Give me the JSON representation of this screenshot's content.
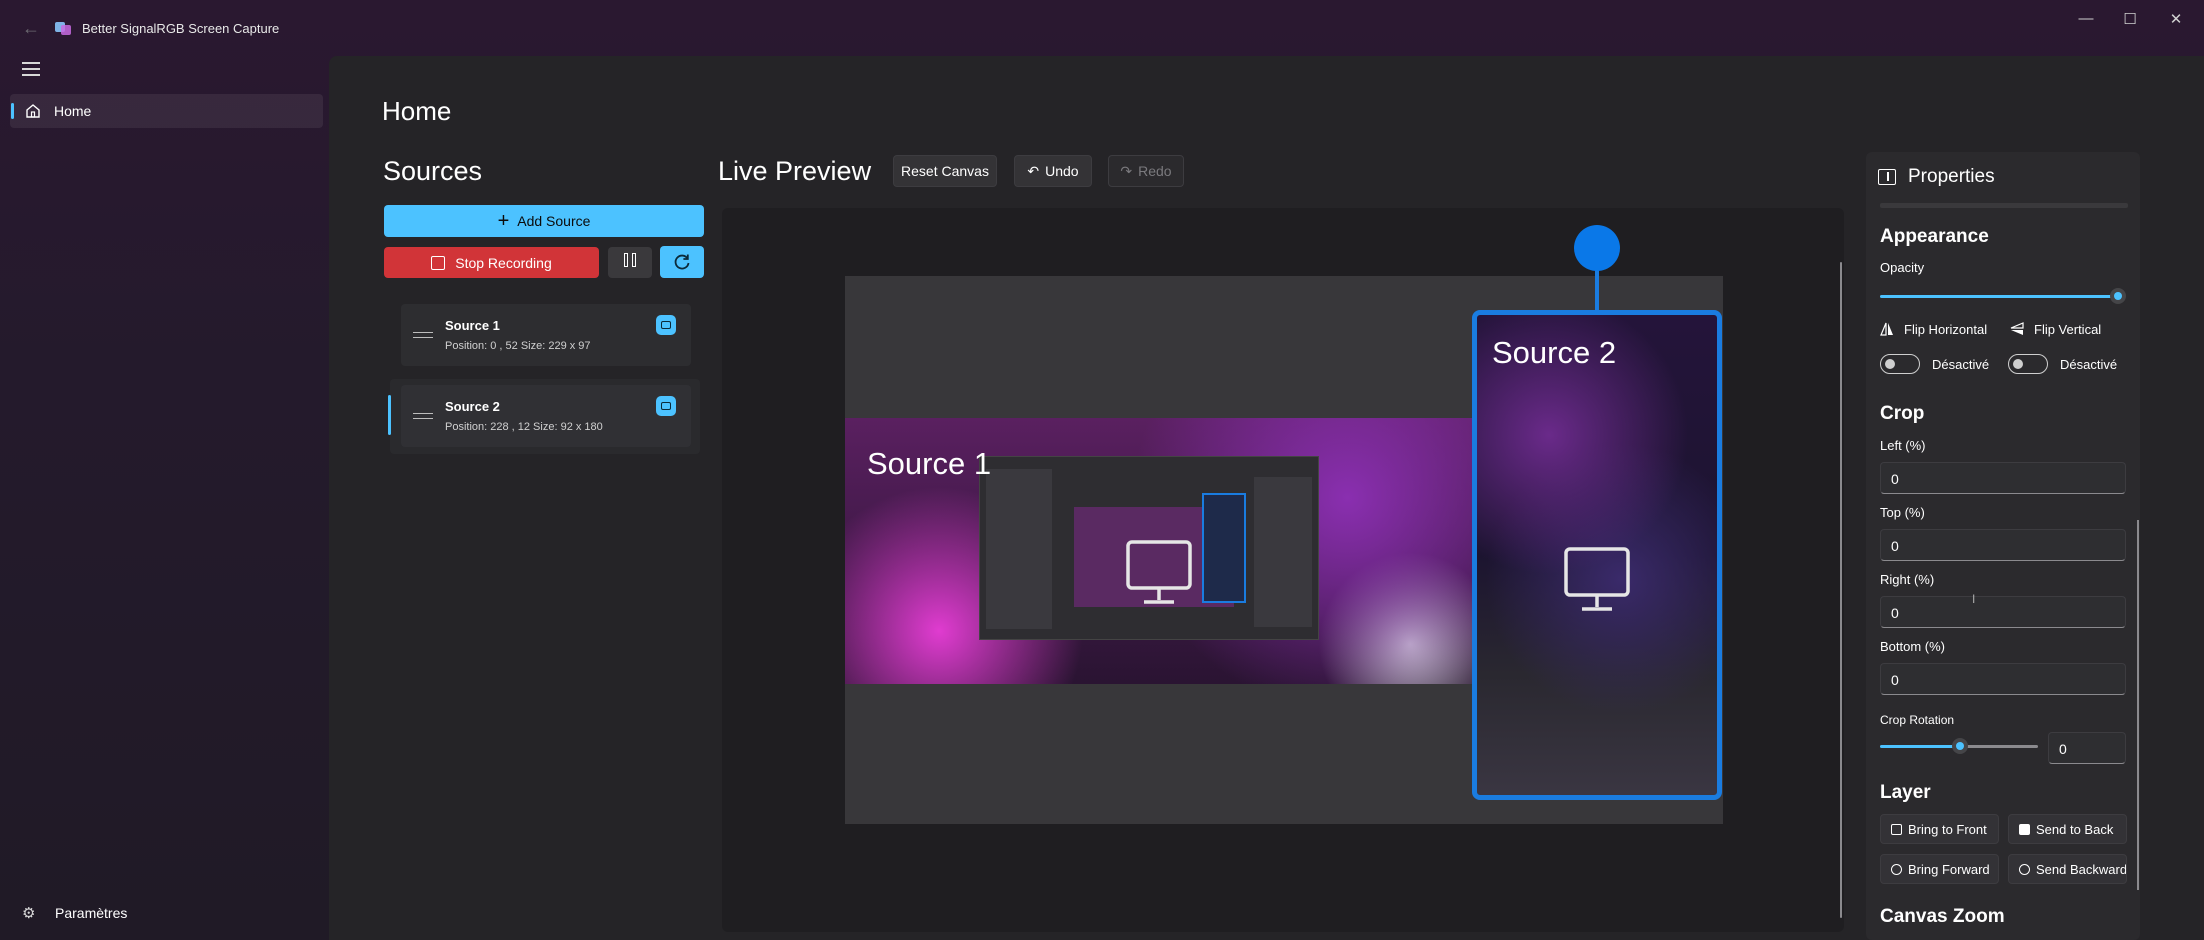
{
  "window": {
    "title": "Better SignalRGB Screen Capture",
    "minimize_glyph": "—",
    "maximize_glyph": "☐",
    "close_glyph": "✕"
  },
  "nav": {
    "home_label": "Home",
    "settings_label": "Paramètres"
  },
  "page": {
    "title": "Home"
  },
  "sources": {
    "title": "Sources",
    "add_label": "Add Source",
    "stop_label": "Stop Recording",
    "items": [
      {
        "name": "Source 1",
        "meta": "Position: 0 , 52  Size: 229 x 97"
      },
      {
        "name": "Source 2",
        "meta": "Position: 228 , 12  Size: 92 x 180"
      }
    ]
  },
  "preview": {
    "title": "Live Preview",
    "reset_label": "Reset Canvas",
    "undo_label": "Undo",
    "redo_label": "Redo",
    "source1_label": "Source 1",
    "source2_label": "Source 2"
  },
  "properties": {
    "title": "Properties",
    "appearance": {
      "heading": "Appearance",
      "opacity_label": "Opacity",
      "opacity_value": 1.0,
      "flip_h_label": "Flip Horizontal",
      "flip_v_label": "Flip Vertical",
      "flip_h_state": "Désactivé",
      "flip_v_state": "Désactivé"
    },
    "crop": {
      "heading": "Crop",
      "left_label": "Left (%)",
      "left_value": "0",
      "top_label": "Top (%)",
      "top_value": "0",
      "right_label": "Right (%)",
      "right_value": "0",
      "bottom_label": "Bottom (%)",
      "bottom_value": "0",
      "rotation_label": "Crop Rotation",
      "rotation_value": "0",
      "rotation_slider_fraction": 0.5
    },
    "layer": {
      "heading": "Layer",
      "bring_front": "Bring to Front",
      "send_back": "Send to Back",
      "bring_forward": "Bring Forward",
      "send_backward": "Send Backward"
    },
    "canvas_zoom_heading": "Canvas Zoom"
  },
  "colors": {
    "accent": "#4cc2ff",
    "stop_red": "#d13438",
    "selection_blue": "#1a7ce0"
  },
  "icons": {
    "back": "arrow-left-icon",
    "app": "app-logo-icon",
    "menu": "hamburger-icon",
    "home": "home-icon",
    "settings": "gear-icon",
    "add": "plus-icon",
    "stop": "stop-icon",
    "pause": "pause-icon",
    "refresh": "refresh-icon",
    "drag": "drag-handle-icon",
    "monitor": "monitor-icon",
    "undo": "undo-icon",
    "redo": "redo-icon",
    "properties": "panel-icon"
  }
}
